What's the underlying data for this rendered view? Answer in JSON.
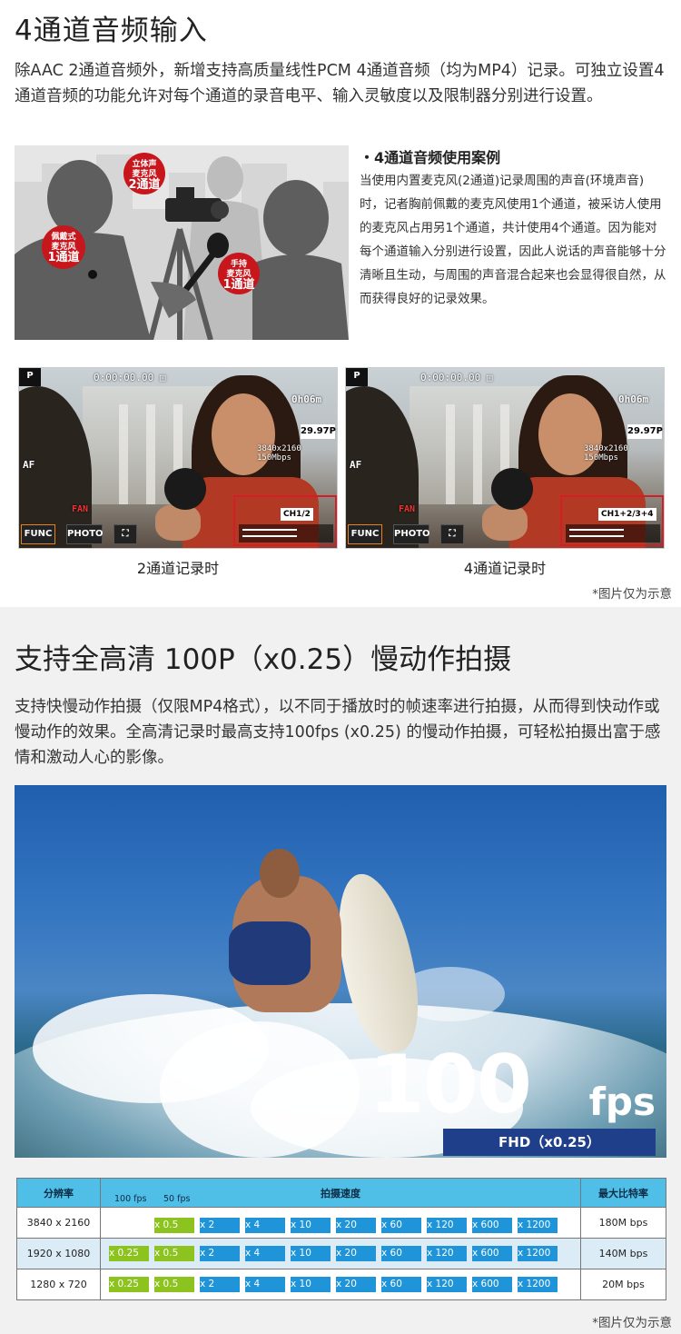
{
  "section1": {
    "title": "4通道音频输入",
    "intro": "除AAC 2通道音频外，新增支持高质量线性PCM 4通道音频（均为MP4）记录。可独立设置4通道音频的功能允许对每个通道的录音电平、输入灵敏度以及限制器分别进行设置。",
    "bubbles": {
      "stereo_line1": "立体声",
      "stereo_line2": "麦克风",
      "stereo_ch": "2通道",
      "lapel_line1": "佩戴式",
      "lapel_line2": "麦克风",
      "lapel_ch": "1通道",
      "hand_line1": "手持",
      "hand_line2": "麦克风",
      "hand_ch": "1通道"
    },
    "case_title": "・4通道音频使用案例",
    "case_body": "当使用内置麦克风(2通道)记录周围的声音(环境声音)时，记者胸前佩戴的麦克风使用1个通道，被采访人使用的麦克风占用另1个通道，共计使用4个通道。因为能对每个通道输入分别进行设置，因此人说话的声音能够十分清晰且生动，与周围的声音混合起来也会显得很自然，从而获得良好的记录效果。",
    "screens": [
      {
        "mode": "P",
        "timecode": "0:00:00.00 □",
        "remain": "0h06m",
        "fps": "29.97P",
        "res": "3840x2160 150Mbps",
        "af": "AF",
        "fan": "FAN",
        "func": "FUNC",
        "photo": "PHOTO",
        "ch": "CH1/2",
        "caption": "2通道记录时"
      },
      {
        "mode": "P",
        "timecode": "0:00:00.00 □",
        "remain": "0h06m",
        "fps": "29.97P",
        "res": "3840x2160 150Mbps",
        "af": "AF",
        "fan": "FAN",
        "func": "FUNC",
        "photo": "PHOTO",
        "ch": "CH1+2/3+4",
        "caption": "4通道记录时"
      }
    ],
    "note": "*图片仅为示意"
  },
  "section2": {
    "title": "支持全高清 100P（x0.25）慢动作拍摄",
    "intro": "支持快慢动作拍摄（仅限MP4格式），以不同于播放时的帧速率进行拍摄，从而得到快动作或慢动作的效果。全高清记录时最高支持100fps (x0.25) 的慢动作拍摄，可轻松拍摄出富于感情和激动人心的影像。",
    "fps_big": "100",
    "fps_unit": "fps",
    "fps_sub": "FHD（x0.25）",
    "table": {
      "headers": {
        "resolution": "分辨率",
        "speed": "拍摄速度",
        "bitrate": "最大比特率",
        "fps100": "100 fps",
        "fps50": "50 fps"
      },
      "rows": [
        {
          "res": "3840 x 2160",
          "cells": [
            "",
            "x 0.5",
            "x 2",
            "x 4",
            "x 10",
            "x 20",
            "x 60",
            "x 120",
            "x 600",
            "x 1200"
          ],
          "bitrate": "180M bps"
        },
        {
          "res": "1920 x 1080",
          "cells": [
            "x 0.25",
            "x 0.5",
            "x 2",
            "x 4",
            "x 10",
            "x 20",
            "x 60",
            "x 120",
            "x 600",
            "x 1200"
          ],
          "bitrate": "140M bps"
        },
        {
          "res": "1280 x 720",
          "cells": [
            "x 0.25",
            "x 0.5",
            "x 2",
            "x 4",
            "x 10",
            "x 20",
            "x 60",
            "x 120",
            "x 600",
            "x 1200"
          ],
          "bitrate": "20M bps"
        }
      ]
    },
    "note": "*图片仅为示意"
  },
  "colors": {
    "accent_red": "#c8161d",
    "table_header": "#4fbfe8",
    "chip_green": "#8cc31e",
    "chip_blue": "#1f94d8",
    "fhd_band": "#1f3f8a"
  }
}
